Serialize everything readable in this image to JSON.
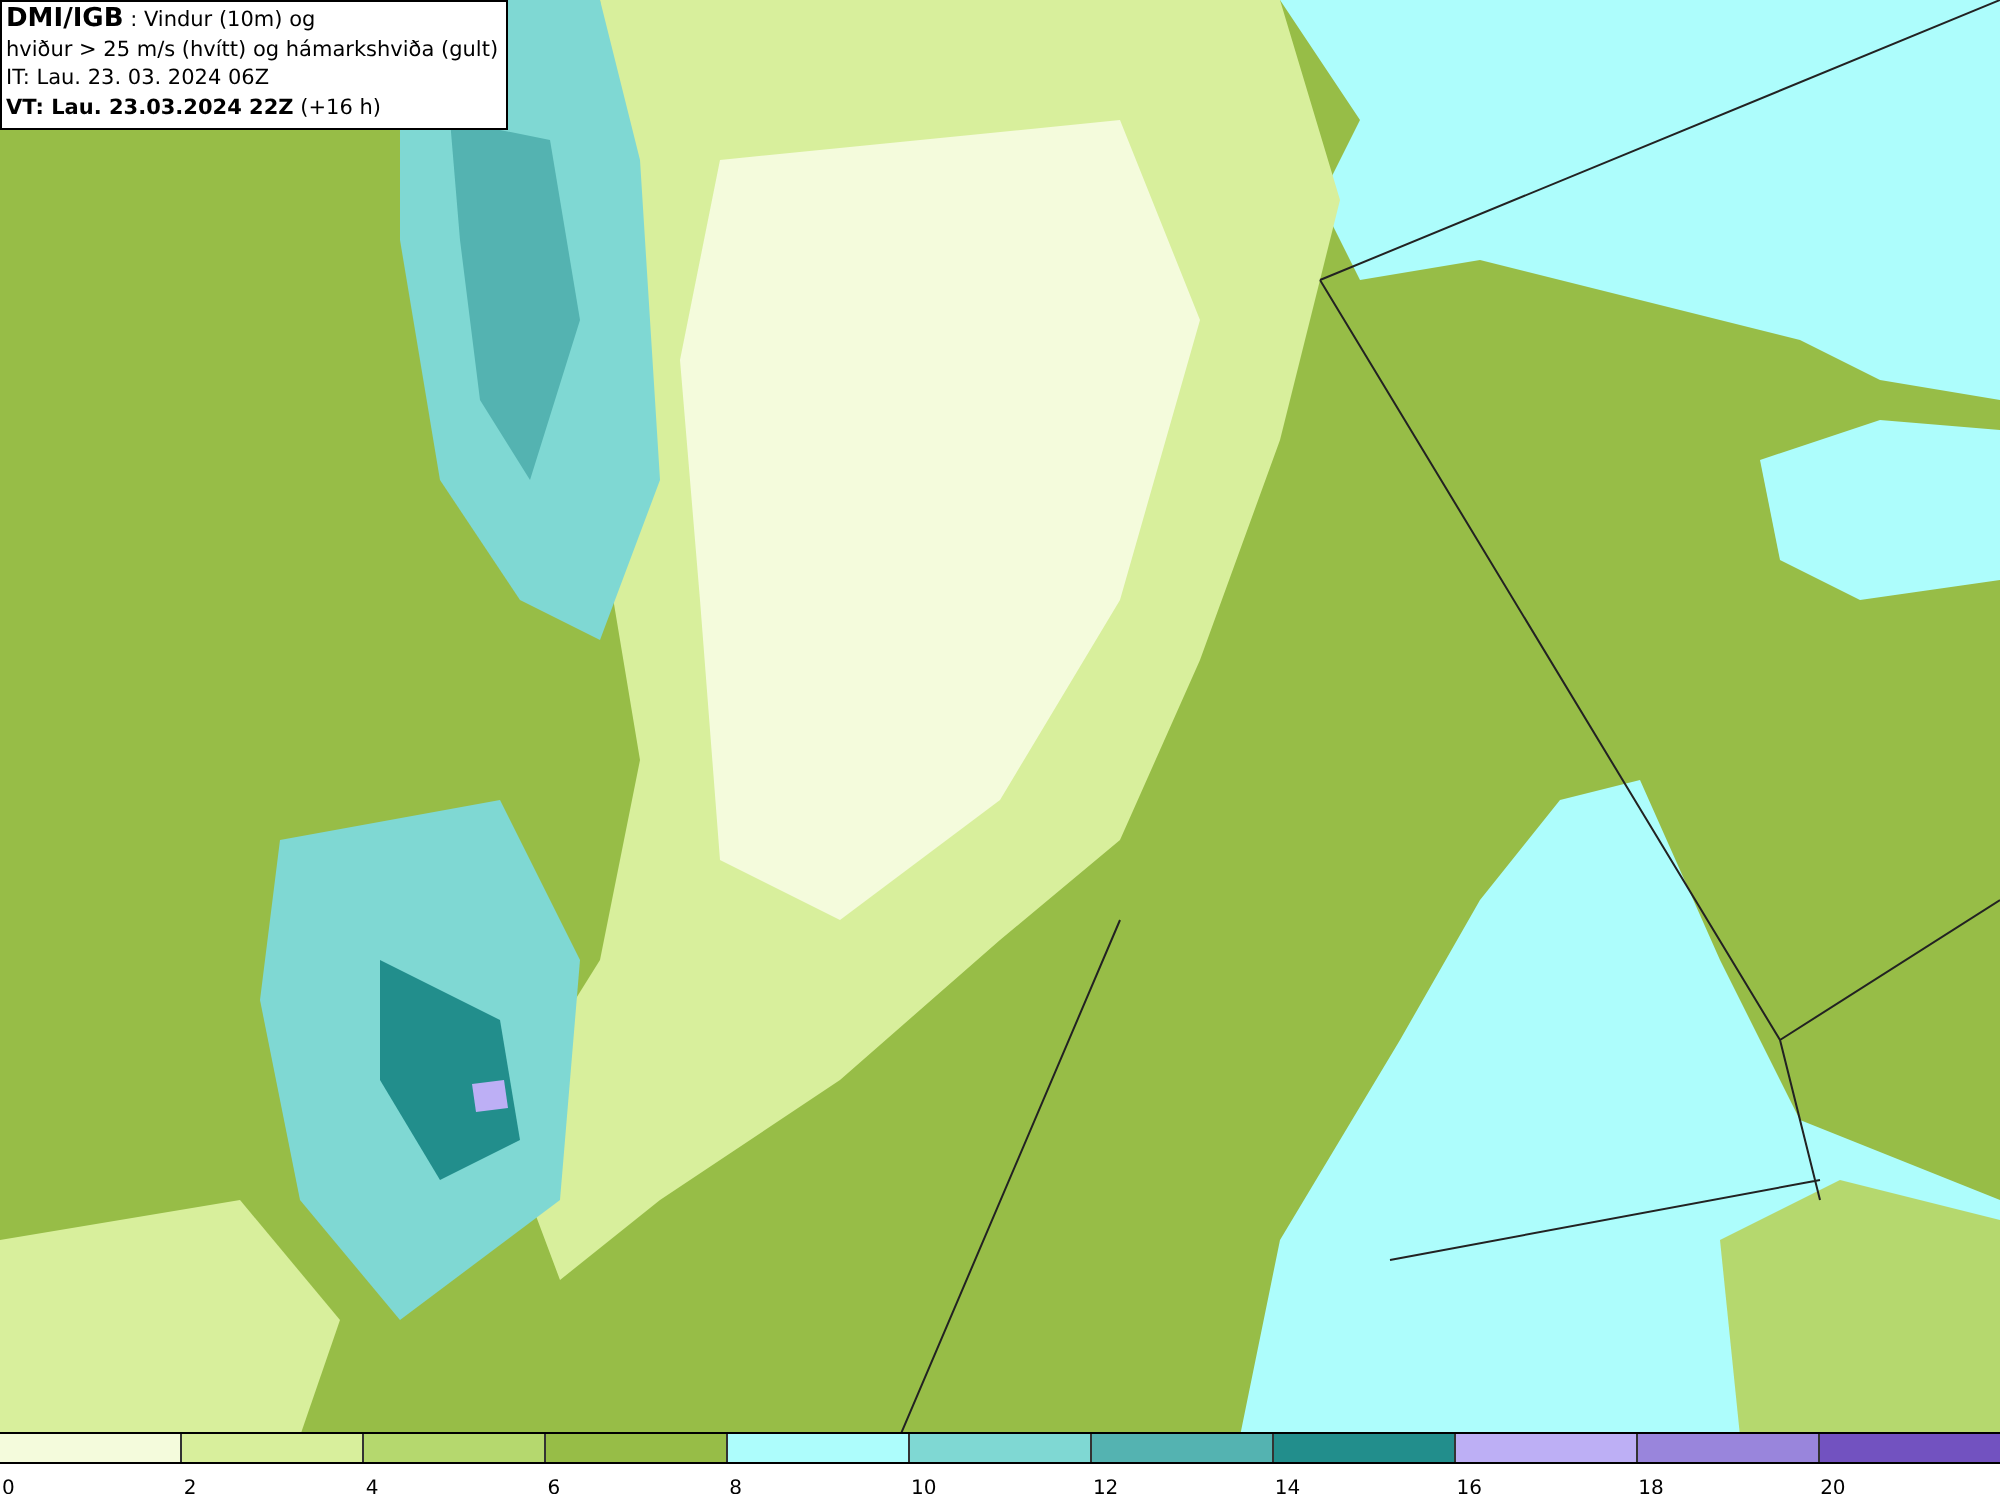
{
  "title_box": {
    "lines": [
      "**DMI/IGB** : Vindur (10m) og",
      "hviður > 25 m/s (hvítt) og hámarkshviða (gult)",
      "IT: Lau. 23. 03. 2024 06Z",
      "**VT: Lau. 23.03.2024 22Z** (+16 h)"
    ]
  },
  "legend": [
    {
      "label": "0",
      "color": "#f4fbdc"
    },
    {
      "label": "2",
      "color": "#d8ef9c"
    },
    {
      "label": "4",
      "color": "#b5d86e"
    },
    {
      "label": "6",
      "color": "#97bd47"
    },
    {
      "label": "8",
      "color": "#adfdfc"
    },
    {
      "label": "10",
      "color": "#7fd8d3"
    },
    {
      "label": "12",
      "color": "#54b3b1"
    },
    {
      "label": "14",
      "color": "#228e8c"
    },
    {
      "label": "16",
      "color": "#bdaff5"
    },
    {
      "label": "18",
      "color": "#9985dc"
    },
    {
      "label": "20",
      "color": "#7252c0"
    }
  ]
}
